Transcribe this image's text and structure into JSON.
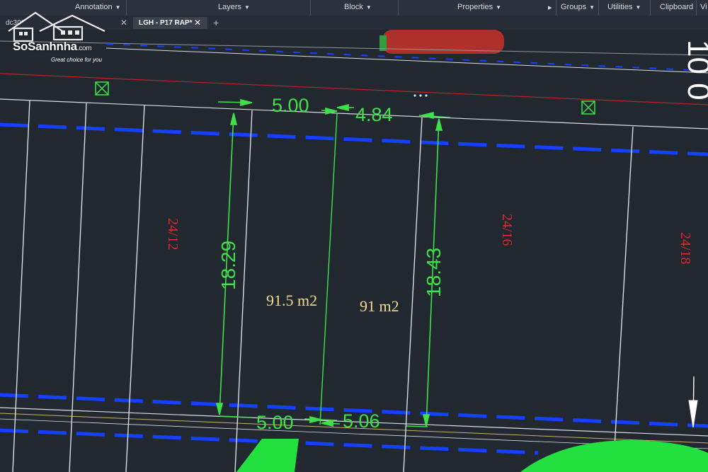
{
  "ribbon": {
    "panels": [
      "Annotation",
      "Layers",
      "Block",
      "Properties",
      "Groups",
      "Utilities",
      "Clipboard",
      "Vi"
    ]
  },
  "tabs": {
    "partial_tab_label": "dc30*",
    "active_tab_label": "LGH - P17 RAP*",
    "new_tab_symbol": "+"
  },
  "watermark": {
    "brand": "SoSanhnha",
    "domain": ".com",
    "tagline": "Great choice for you"
  },
  "drawing": {
    "dims_top": [
      "5.00",
      "4.84"
    ],
    "dims_bottom": [
      "5.00",
      "5.06"
    ],
    "dims_side": [
      "18.29",
      "18.43"
    ],
    "areas": [
      "91.5 m2",
      "91 m2"
    ],
    "lot_labels": [
      "24/12",
      "24/16",
      "24/18"
    ],
    "road_label": "10 0",
    "colors": {
      "background": "#212830",
      "dimension": "#3fe04a",
      "area_text": "#f0dc8c",
      "lot_label": "#e8242c",
      "boundary_blue": "#1540ff",
      "red_line": "#c0202a",
      "lot_lines": "#d8dde3"
    }
  }
}
